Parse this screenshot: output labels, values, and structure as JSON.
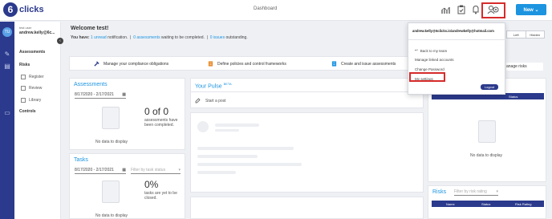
{
  "app": {
    "logo_letter": "6",
    "logo_text": "clicks",
    "page_title": "Dashboard"
  },
  "header": {
    "new_button": "New ⌄"
  },
  "sidebar": {
    "avatar_initials": "TU",
    "user_small": "test user",
    "user_name": "andrew.kelly@6c...",
    "items": {
      "assessments": "Assessments",
      "risks": "Risks",
      "register": "Register",
      "review": "Review",
      "library": "Library",
      "controls": "Controls"
    }
  },
  "welcome": {
    "title": "Welcome test!",
    "you_have": "You have:",
    "unread": "1 unread",
    "notification": "notification.",
    "assessments_waiting": "0 assessments",
    "waiting_text": "waiting to be completed.",
    "issues": "0 issues",
    "outstanding": "outstanding."
  },
  "quick_actions": [
    "Manage your compliance obligations",
    "Define policies and control frameworks",
    "Create and issue assessments",
    "anage risks"
  ],
  "assessments_card": {
    "title": "Assessments",
    "date_range": "8/17/2020 - 2/17/2021",
    "count": "0 of 0",
    "desc": "assessments have been completed.",
    "nodata": "No data to display"
  },
  "tasks_card": {
    "title": "Tasks",
    "date_range": "8/17/2020 - 2/17/2021",
    "filter_placeholder": "Filter by task status",
    "percent": "0%",
    "desc": "tasks are yet to be closed.",
    "nodata": "No data to display"
  },
  "pulse": {
    "title": "Your Pulse",
    "beta": "BETA",
    "start_post": "Start a post"
  },
  "right_top_card": {
    "col_status": "Status",
    "nodata": "No data to display"
  },
  "risks_card": {
    "title": "Risks",
    "filter_placeholder": "Filter by risk rating",
    "col_name": "Name",
    "col_status": "Status",
    "col_rating": "Risk Rating"
  },
  "account_menu": {
    "email": "andrew.kelly@6clicks.io\\andrewkelly@hotmail.com",
    "back": "Back to my team",
    "manage": "Manage linked accounts",
    "change_password": "Change Password",
    "my_settings": "My settings",
    "logout": "Logout",
    "seg_left": "Left",
    "seg_hidden": "Hidden"
  },
  "colors": {
    "brand": "#2b3a8c",
    "accent": "#1c94e0",
    "highlight": "#d62b2b"
  }
}
